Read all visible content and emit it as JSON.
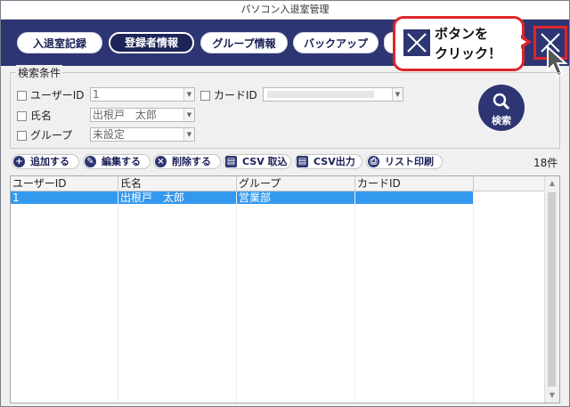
{
  "window": {
    "title": "パソコン入退室管理"
  },
  "nav": {
    "tabs": [
      {
        "label": "入退室記録"
      },
      {
        "label": "登録者情報"
      },
      {
        "label": "グループ情報"
      },
      {
        "label": "バックアップ"
      }
    ],
    "active_tab": "登録者情報"
  },
  "callout": {
    "line1": "ボタンを",
    "line2": "クリック！"
  },
  "search": {
    "group_title": "検索条件",
    "user_id": {
      "label": "ユーザーID",
      "value": "1"
    },
    "card_id": {
      "label": "カードID",
      "value": ""
    },
    "name": {
      "label": "氏名",
      "value": "出根戸　太郎"
    },
    "group": {
      "label": "グループ",
      "value": "未設定"
    },
    "button_label": "検索"
  },
  "toolbar": {
    "add": "追加する",
    "edit": "編集する",
    "delete": "削除する",
    "csv_import": "CSV 取込",
    "csv_export": "CSV出力",
    "print_list": "リスト印刷"
  },
  "count": "18件",
  "table": {
    "columns": [
      "ユーザーID",
      "氏名",
      "グループ",
      "カードID"
    ],
    "rows": [
      {
        "user_id": "1",
        "name": "出根戸　太郎",
        "group": "営業部",
        "card_id": ""
      }
    ]
  },
  "colors": {
    "navy": "#2d3673",
    "highlight": "#3399ee",
    "callout_red": "#e0252a"
  },
  "icons": [
    "close-icon",
    "search-icon",
    "plus-icon",
    "pencil-icon",
    "delete-icon",
    "csv-icon",
    "printer-icon",
    "cursor-arrow-icon"
  ]
}
